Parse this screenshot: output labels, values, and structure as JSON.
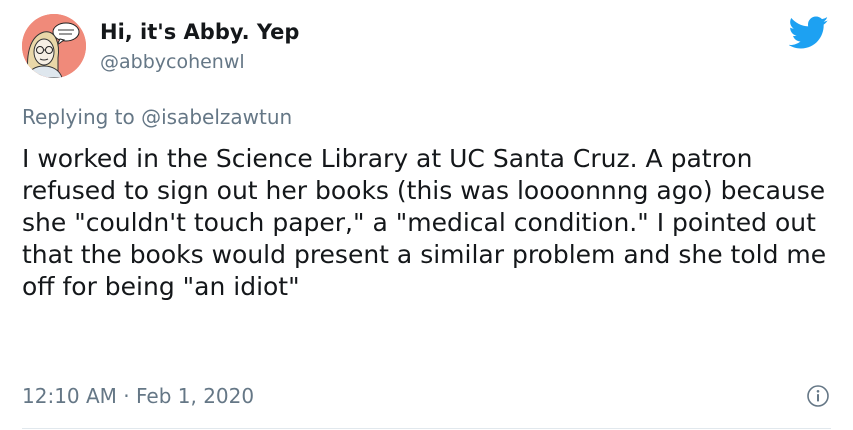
{
  "author": {
    "display_name": "Hi, it's Abby. Yep",
    "handle": "@abbycohenwl",
    "avatar_icon": "avatar-illustration"
  },
  "reply": {
    "prefix": "Replying to",
    "to_handle": "@isabelzawtun"
  },
  "tweet": {
    "text": "I worked in the Science Library at UC Santa Cruz. A patron refused to sign out her books (this was loooonnng ago) because she \"couldn't touch paper,\" a \"medical condition.\" I pointed out that the books would present a similar problem and she told me off for being \"an idiot\""
  },
  "meta": {
    "timestamp": "12:10 AM · Feb 1, 2020"
  },
  "icons": {
    "brand": "twitter-bird-icon",
    "info": "info-icon"
  },
  "colors": {
    "twitter_blue": "#1da1f2",
    "text_primary": "#14171a",
    "text_secondary": "#657786",
    "link": "#1b95e0",
    "avatar_bg": "#f08a7a"
  }
}
